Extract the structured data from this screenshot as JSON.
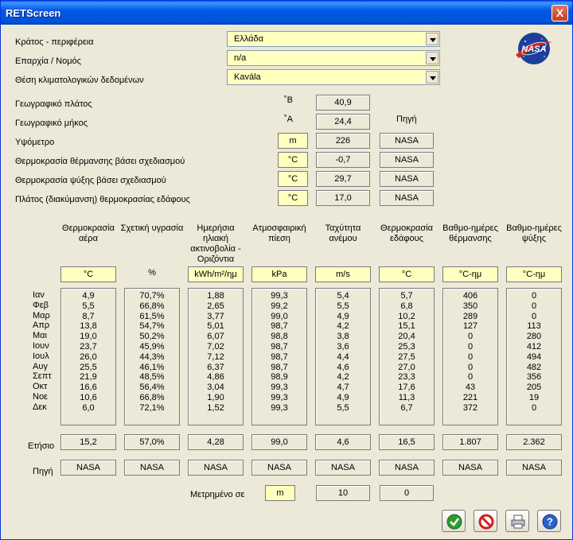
{
  "window": {
    "title": "RETScreen",
    "close": "X"
  },
  "location": {
    "country_label": "Κράτος - περιφέρεια",
    "country_value": "Ελλάδα",
    "province_label": "Επαρχία / Νομός",
    "province_value": "n/a",
    "site_label": "Θέση κλιματολογικών δεδομένων",
    "site_value": "Kavála"
  },
  "site_params": {
    "latitude_label": "Γεωγραφικό πλάτος",
    "latitude_unit": "˚Β",
    "latitude_value": "40,9",
    "longitude_label": "Γεωγραφικό μήκος",
    "longitude_unit": "˚Α",
    "longitude_value": "24,4",
    "source_header": "Πηγή",
    "elevation_label": "Υψόμετρο",
    "elevation_unit": "m",
    "elevation_value": "226",
    "elevation_source": "NASA",
    "heating_temp_label": "Θερμοκρασία θέρμανσης βάσει σχεδιασμού",
    "heating_temp_unit": "°C",
    "heating_temp_value": "-0,7",
    "heating_temp_source": "NASA",
    "cooling_temp_label": "Θερμοκρασία ψύξης βάσει σχεδιασμού",
    "cooling_temp_unit": "°C",
    "cooling_temp_value": "29,7",
    "cooling_temp_source": "NASA",
    "ground_amp_label": "Πλάτος (διακύμανση) θερμοκρασίας εδάφους",
    "ground_amp_unit": "°C",
    "ground_amp_value": "17,0",
    "ground_amp_source": "NASA"
  },
  "columns": [
    {
      "header": "Θερμοκρασία αέρα",
      "unit": "°C",
      "unit_boxed": true,
      "values": [
        "4,9",
        "5,5",
        "8,7",
        "13,8",
        "19,0",
        "23,7",
        "26,0",
        "25,5",
        "21,9",
        "16,6",
        "10,6",
        "6,0"
      ],
      "annual": "15,2",
      "source": "NASA"
    },
    {
      "header": "Σχετική υγρασία",
      "unit": "%",
      "unit_boxed": false,
      "values": [
        "70,7%",
        "66,8%",
        "61,5%",
        "54,7%",
        "50,2%",
        "45,9%",
        "44,3%",
        "46,1%",
        "48,5%",
        "56,4%",
        "66,8%",
        "72,1%"
      ],
      "annual": "57,0%",
      "source": "NASA"
    },
    {
      "header": "Ημερήσια ηλιακή ακτινοβολία - Οριζόντια",
      "unit": "kWh/m²/ημ",
      "unit_boxed": true,
      "values": [
        "1,88",
        "2,65",
        "3,77",
        "5,01",
        "6,07",
        "7,02",
        "7,12",
        "6,37",
        "4,86",
        "3,04",
        "1,90",
        "1,52"
      ],
      "annual": "4,28",
      "source": "NASA"
    },
    {
      "header": "Ατμοσφαιρική πίεση",
      "unit": "kPa",
      "unit_boxed": true,
      "values": [
        "99,3",
        "99,2",
        "99,0",
        "98,7",
        "98,8",
        "98,7",
        "98,7",
        "98,7",
        "98,9",
        "99,3",
        "99,3",
        "99,3"
      ],
      "annual": "99,0",
      "source": "NASA"
    },
    {
      "header": "Ταχύτητα ανέμου",
      "unit": "m/s",
      "unit_boxed": true,
      "values": [
        "5,4",
        "5,5",
        "4,9",
        "4,2",
        "3,8",
        "3,6",
        "4,4",
        "4,6",
        "4,2",
        "4,7",
        "4,9",
        "5,5"
      ],
      "annual": "4,6",
      "source": "NASA"
    },
    {
      "header": "Θερμοκρασία εδάφους",
      "unit": "°C",
      "unit_boxed": true,
      "values": [
        "5,7",
        "6,8",
        "10,2",
        "15,1",
        "20,4",
        "25,3",
        "27,5",
        "27,0",
        "23,3",
        "17,6",
        "11,3",
        "6,7"
      ],
      "annual": "16,5",
      "source": "NASA"
    },
    {
      "header": "Βαθμο-ημέρες θέρμανσης",
      "unit": "°C-ημ",
      "unit_boxed": true,
      "values": [
        "406",
        "350",
        "289",
        "127",
        "0",
        "0",
        "0",
        "0",
        "0",
        "43",
        "221",
        "372"
      ],
      "annual": "1.807",
      "source": "NASA"
    },
    {
      "header": "Βαθμο-ημέρες ψύξης",
      "unit": "°C-ημ",
      "unit_boxed": true,
      "values": [
        "0",
        "0",
        "0",
        "113",
        "280",
        "412",
        "494",
        "482",
        "356",
        "205",
        "19",
        "0"
      ],
      "annual": "2.362",
      "source": "NASA"
    }
  ],
  "months": [
    "Ιαν",
    "Φεβ",
    "Μαρ",
    "Απρ",
    "Μαι",
    "Ιουν",
    "Ιουλ",
    "Αυγ",
    "Σεπτ",
    "Οκτ",
    "Νοε",
    "Δεκ"
  ],
  "annual_label": "Ετήσιο",
  "source_label": "Πηγή",
  "measured": {
    "label": "Μετρημένο σε",
    "unit": "m",
    "wind_height": "10",
    "ground_height": "0"
  },
  "logo": {
    "text": "NASA"
  },
  "buttons": {
    "ok": "ok-icon",
    "cancel": "cancel-icon",
    "print": "printer-icon",
    "help": "help-icon"
  },
  "colors": {
    "input_yellow": "#ffffc0",
    "title_blue": "#0058e6",
    "window_bg": "#ece9d8"
  }
}
